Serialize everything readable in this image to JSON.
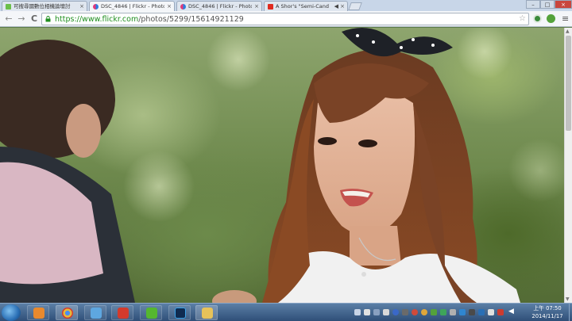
{
  "browser": {
    "tabs": [
      {
        "title": "可搜尋國數位相機論壇討",
        "favicon_color": "#6bbf4a",
        "active": false
      },
      {
        "title": "DSC_4846 | Flickr - Photo",
        "favicon_color": "#e3397a",
        "active": true
      },
      {
        "title": "DSC_4846 | Flickr - Photo",
        "favicon_color": "#e3397a",
        "active": false
      },
      {
        "title": "A Shor's \"Semi-Cand",
        "favicon_color": "#e02b20",
        "active": false
      }
    ],
    "tab_close_glyph": "×",
    "window_controls": [
      "–",
      "□",
      "×"
    ],
    "nav": {
      "back_glyph": "←",
      "forward_glyph": "→",
      "reload_glyph": "C"
    },
    "address": {
      "scheme_host": "https://www.flickr.com",
      "path": "/photos/5299/15614921129"
    },
    "star_glyph": "☆",
    "menu_glyph": "≡",
    "extensions": [
      {
        "icon": "flickr-extension-icon",
        "color": "#3b8b3b"
      },
      {
        "icon": "evernote-icon",
        "color": "#54a23b"
      }
    ]
  },
  "taskbar": {
    "pinned": [
      {
        "icon": "chrome-icon",
        "color": "#e8b73a"
      },
      {
        "icon": "photo-viewer-icon",
        "color": "#5ea7e0"
      },
      {
        "icon": "foxit-icon",
        "color": "#d33a2c"
      },
      {
        "icon": "line-icon",
        "color": "#55b730"
      },
      {
        "icon": "photoshop-icon",
        "color": "#0f2b50"
      },
      {
        "icon": "explorer-icon",
        "color": "#e7c25a"
      }
    ],
    "clock": {
      "time": "上午 07:50",
      "date": "2014/11/17"
    }
  }
}
